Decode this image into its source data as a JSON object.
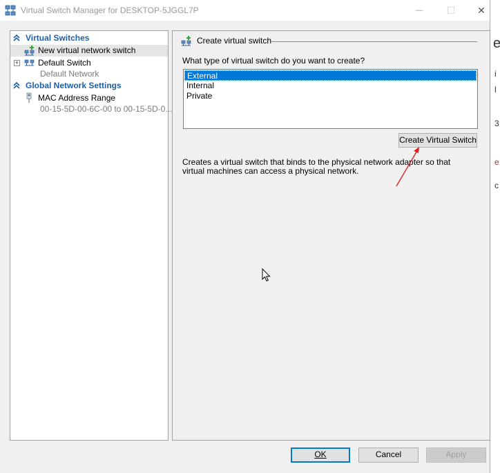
{
  "window": {
    "title": "Virtual Switch Manager for DESKTOP-5JGGL7P",
    "controls": {
      "minimize": "—",
      "maximize": "☐",
      "close": "✕"
    }
  },
  "tree": {
    "virtual_switches_header": "Virtual Switches",
    "new_switch": "New virtual network switch",
    "default_switch": "Default Switch",
    "default_switch_sub": "Default Network",
    "global_header": "Global Network Settings",
    "mac_range": "MAC Address Range",
    "mac_range_sub": "00-15-5D-00-6C-00 to 00-15-5D-0..."
  },
  "panel": {
    "group_title": "Create virtual switch",
    "question": "What type of virtual switch do you want to create?",
    "options": [
      "External",
      "Internal",
      "Private"
    ],
    "selected_option": "External",
    "create_button": "Create Virtual Switch",
    "description": "Creates a virtual switch that binds to the physical network adapter so that virtual machines can access a physical network."
  },
  "footer": {
    "ok": "OK",
    "cancel": "Cancel",
    "apply": "Apply"
  },
  "background_window": {
    "fragments": [
      "e",
      "i",
      "l",
      "3",
      "e",
      "c"
    ]
  },
  "colors": {
    "accent": "#0078d7",
    "section_header": "#1f5fa6",
    "annotation_arrow": "#e02020"
  }
}
